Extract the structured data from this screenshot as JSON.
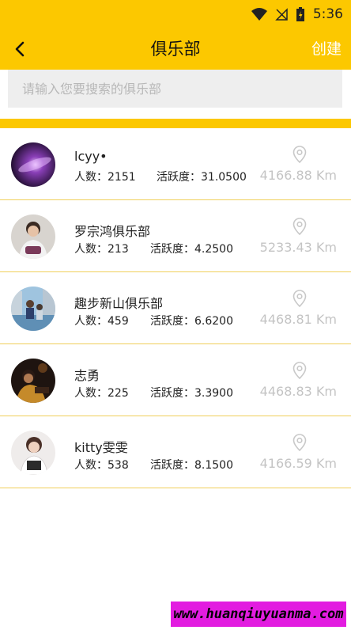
{
  "status_bar": {
    "time": "5:36"
  },
  "app_bar": {
    "title": "俱乐部",
    "create_label": "创建"
  },
  "search": {
    "placeholder": "请输入您要搜索的俱乐部",
    "value": ""
  },
  "clubs": [
    {
      "name": "lcyy•",
      "members": "人数：2151",
      "activity": "活跃度：31.0500",
      "distance": "4166.88 Km"
    },
    {
      "name": "罗宗鸿俱乐部",
      "members": "人数：213",
      "activity": "活跃度：4.2500",
      "distance": "5233.43 Km"
    },
    {
      "name": "趣步新山俱乐部",
      "members": "人数：459",
      "activity": "活跃度：6.6200",
      "distance": "4468.81 Km"
    },
    {
      "name": "志勇",
      "members": "人数：225",
      "activity": "活跃度：3.3900",
      "distance": "4468.83 Km"
    },
    {
      "name": "kitty雯雯",
      "members": "人数：538",
      "activity": "活跃度：8.1500",
      "distance": "4166.59 Km"
    }
  ],
  "watermark": "www.huanqiuyuanma.com",
  "colors": {
    "accent": "#fcc800",
    "divider": "#f0cf5a",
    "distance_text": "#c4c4c4"
  }
}
